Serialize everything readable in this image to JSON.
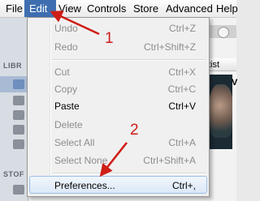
{
  "menubar": {
    "items": [
      "File",
      "Edit",
      "View",
      "Controls",
      "Store",
      "Advanced",
      "Help"
    ],
    "active": "Edit"
  },
  "background": {
    "sidebar_headings": [
      "LIBR",
      "STOF"
    ],
    "column_header": "tist",
    "artwork_letter": "V"
  },
  "edit_menu": {
    "items": [
      {
        "label": "Undo",
        "shortcut": "Ctrl+Z",
        "enabled": false
      },
      {
        "label": "Redo",
        "shortcut": "Ctrl+Shift+Z",
        "enabled": false
      },
      {
        "label": "Cut",
        "shortcut": "Ctrl+X",
        "enabled": false
      },
      {
        "label": "Copy",
        "shortcut": "Ctrl+C",
        "enabled": false
      },
      {
        "label": "Paste",
        "shortcut": "Ctrl+V",
        "enabled": true
      },
      {
        "label": "Delete",
        "shortcut": "",
        "enabled": false
      },
      {
        "label": "Select All",
        "shortcut": "Ctrl+A",
        "enabled": false
      },
      {
        "label": "Select None",
        "shortcut": "Ctrl+Shift+A",
        "enabled": false
      },
      {
        "label": "Preferences...",
        "shortcut": "Ctrl+,",
        "enabled": true,
        "highlighted": true
      }
    ]
  },
  "annotations": {
    "step1": "1",
    "step2": "2",
    "arrow_color": "#cf1d17"
  }
}
